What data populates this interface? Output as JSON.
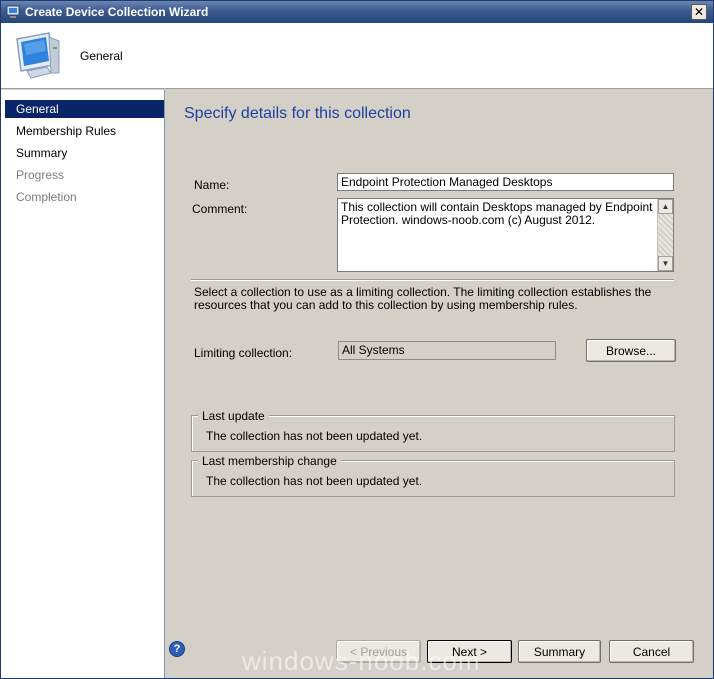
{
  "window": {
    "title": "Create Device Collection Wizard",
    "close_glyph": "✕"
  },
  "header": {
    "title": "General",
    "icon": "computer-monitor-icon"
  },
  "nav": {
    "items": [
      {
        "label": "General",
        "state": "active"
      },
      {
        "label": "Membership Rules",
        "state": "enabled"
      },
      {
        "label": "Summary",
        "state": "enabled"
      },
      {
        "label": "Progress",
        "state": "disabled"
      },
      {
        "label": "Completion",
        "state": "disabled"
      }
    ]
  },
  "content": {
    "title": "Specify details for this collection",
    "name_label": "Name:",
    "name_value": "Endpoint Protection Managed Desktops",
    "comment_label": "Comment:",
    "comment_value": "This collection will contain Desktops managed by Endpoint Protection. windows-noob.com (c) August 2012.",
    "description": "Select a collection to use as a limiting collection. The limiting collection establishes the resources that you can add to this collection by using membership rules.",
    "limiting_label": "Limiting collection:",
    "limiting_value": "All Systems",
    "browse_label": "Browse...",
    "last_update": {
      "legend": "Last update",
      "text": "The collection has not been updated yet."
    },
    "last_membership_change": {
      "legend": "Last membership change",
      "text": "The collection has not been updated yet."
    }
  },
  "footer": {
    "help_glyph": "?",
    "previous_label": "< Previous",
    "next_label": "Next >",
    "summary_label": "Summary",
    "cancel_label": "Cancel"
  },
  "watermark": "windows-noob.com",
  "colors": {
    "title_bar": "#26457a",
    "nav_active": "#0a246a",
    "page_title": "#1f3fa0",
    "dialog_bg": "#d4d0c8"
  }
}
